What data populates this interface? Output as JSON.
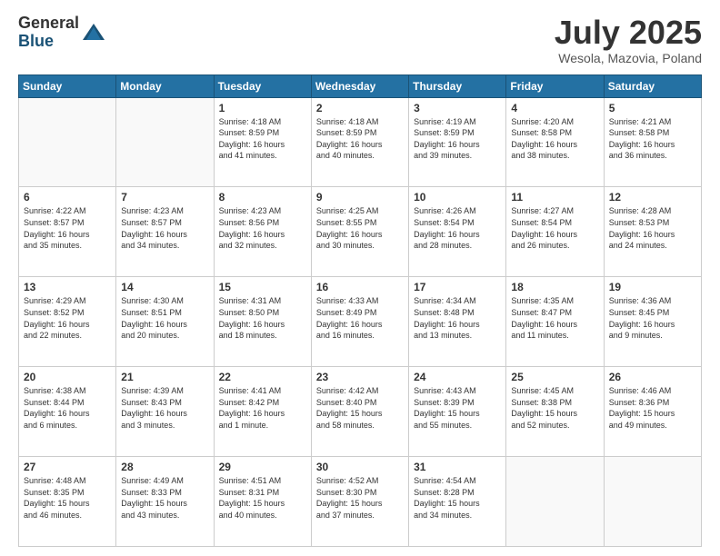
{
  "header": {
    "logo_line1": "General",
    "logo_line2": "Blue",
    "month": "July 2025",
    "location": "Wesola, Mazovia, Poland"
  },
  "days_of_week": [
    "Sunday",
    "Monday",
    "Tuesday",
    "Wednesday",
    "Thursday",
    "Friday",
    "Saturday"
  ],
  "weeks": [
    [
      {
        "day": "",
        "info": ""
      },
      {
        "day": "",
        "info": ""
      },
      {
        "day": "1",
        "info": "Sunrise: 4:18 AM\nSunset: 8:59 PM\nDaylight: 16 hours\nand 41 minutes."
      },
      {
        "day": "2",
        "info": "Sunrise: 4:18 AM\nSunset: 8:59 PM\nDaylight: 16 hours\nand 40 minutes."
      },
      {
        "day": "3",
        "info": "Sunrise: 4:19 AM\nSunset: 8:59 PM\nDaylight: 16 hours\nand 39 minutes."
      },
      {
        "day": "4",
        "info": "Sunrise: 4:20 AM\nSunset: 8:58 PM\nDaylight: 16 hours\nand 38 minutes."
      },
      {
        "day": "5",
        "info": "Sunrise: 4:21 AM\nSunset: 8:58 PM\nDaylight: 16 hours\nand 36 minutes."
      }
    ],
    [
      {
        "day": "6",
        "info": "Sunrise: 4:22 AM\nSunset: 8:57 PM\nDaylight: 16 hours\nand 35 minutes."
      },
      {
        "day": "7",
        "info": "Sunrise: 4:23 AM\nSunset: 8:57 PM\nDaylight: 16 hours\nand 34 minutes."
      },
      {
        "day": "8",
        "info": "Sunrise: 4:23 AM\nSunset: 8:56 PM\nDaylight: 16 hours\nand 32 minutes."
      },
      {
        "day": "9",
        "info": "Sunrise: 4:25 AM\nSunset: 8:55 PM\nDaylight: 16 hours\nand 30 minutes."
      },
      {
        "day": "10",
        "info": "Sunrise: 4:26 AM\nSunset: 8:54 PM\nDaylight: 16 hours\nand 28 minutes."
      },
      {
        "day": "11",
        "info": "Sunrise: 4:27 AM\nSunset: 8:54 PM\nDaylight: 16 hours\nand 26 minutes."
      },
      {
        "day": "12",
        "info": "Sunrise: 4:28 AM\nSunset: 8:53 PM\nDaylight: 16 hours\nand 24 minutes."
      }
    ],
    [
      {
        "day": "13",
        "info": "Sunrise: 4:29 AM\nSunset: 8:52 PM\nDaylight: 16 hours\nand 22 minutes."
      },
      {
        "day": "14",
        "info": "Sunrise: 4:30 AM\nSunset: 8:51 PM\nDaylight: 16 hours\nand 20 minutes."
      },
      {
        "day": "15",
        "info": "Sunrise: 4:31 AM\nSunset: 8:50 PM\nDaylight: 16 hours\nand 18 minutes."
      },
      {
        "day": "16",
        "info": "Sunrise: 4:33 AM\nSunset: 8:49 PM\nDaylight: 16 hours\nand 16 minutes."
      },
      {
        "day": "17",
        "info": "Sunrise: 4:34 AM\nSunset: 8:48 PM\nDaylight: 16 hours\nand 13 minutes."
      },
      {
        "day": "18",
        "info": "Sunrise: 4:35 AM\nSunset: 8:47 PM\nDaylight: 16 hours\nand 11 minutes."
      },
      {
        "day": "19",
        "info": "Sunrise: 4:36 AM\nSunset: 8:45 PM\nDaylight: 16 hours\nand 9 minutes."
      }
    ],
    [
      {
        "day": "20",
        "info": "Sunrise: 4:38 AM\nSunset: 8:44 PM\nDaylight: 16 hours\nand 6 minutes."
      },
      {
        "day": "21",
        "info": "Sunrise: 4:39 AM\nSunset: 8:43 PM\nDaylight: 16 hours\nand 3 minutes."
      },
      {
        "day": "22",
        "info": "Sunrise: 4:41 AM\nSunset: 8:42 PM\nDaylight: 16 hours\nand 1 minute."
      },
      {
        "day": "23",
        "info": "Sunrise: 4:42 AM\nSunset: 8:40 PM\nDaylight: 15 hours\nand 58 minutes."
      },
      {
        "day": "24",
        "info": "Sunrise: 4:43 AM\nSunset: 8:39 PM\nDaylight: 15 hours\nand 55 minutes."
      },
      {
        "day": "25",
        "info": "Sunrise: 4:45 AM\nSunset: 8:38 PM\nDaylight: 15 hours\nand 52 minutes."
      },
      {
        "day": "26",
        "info": "Sunrise: 4:46 AM\nSunset: 8:36 PM\nDaylight: 15 hours\nand 49 minutes."
      }
    ],
    [
      {
        "day": "27",
        "info": "Sunrise: 4:48 AM\nSunset: 8:35 PM\nDaylight: 15 hours\nand 46 minutes."
      },
      {
        "day": "28",
        "info": "Sunrise: 4:49 AM\nSunset: 8:33 PM\nDaylight: 15 hours\nand 43 minutes."
      },
      {
        "day": "29",
        "info": "Sunrise: 4:51 AM\nSunset: 8:31 PM\nDaylight: 15 hours\nand 40 minutes."
      },
      {
        "day": "30",
        "info": "Sunrise: 4:52 AM\nSunset: 8:30 PM\nDaylight: 15 hours\nand 37 minutes."
      },
      {
        "day": "31",
        "info": "Sunrise: 4:54 AM\nSunset: 8:28 PM\nDaylight: 15 hours\nand 34 minutes."
      },
      {
        "day": "",
        "info": ""
      },
      {
        "day": "",
        "info": ""
      }
    ]
  ]
}
